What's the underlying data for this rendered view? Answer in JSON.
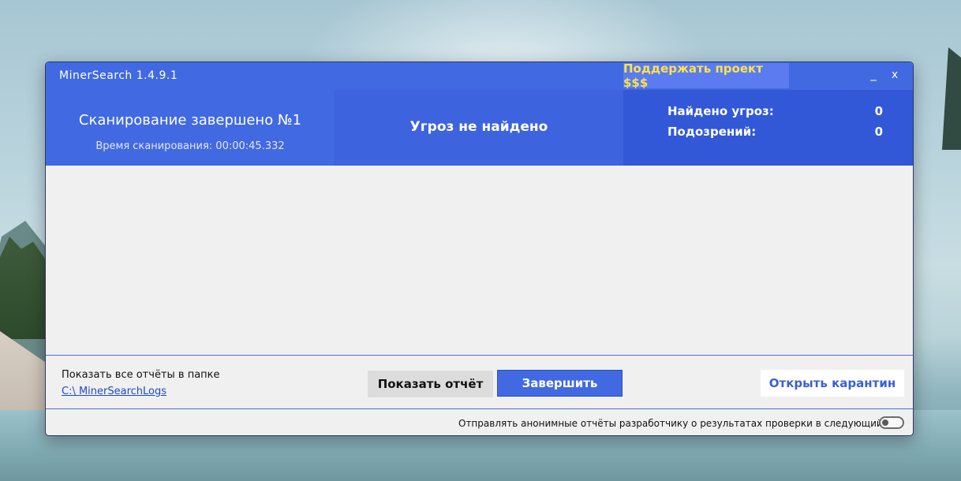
{
  "window": {
    "title": "MinerSearch 1.4.9.1",
    "support_label": "Поддержать проект $$$",
    "minimize_glyph": "_",
    "close_glyph": "x"
  },
  "summary": {
    "scan_title": "Сканирование завершено №1",
    "scan_time": "Время сканирования: 00:00:45.332",
    "status": "Угроз не найдено",
    "threats_label": "Найдено угроз:",
    "threats_value": "0",
    "suspicions_label": "Подозрений:",
    "suspicions_value": "0"
  },
  "footer": {
    "logs_label": "Показать все отчёты в папке",
    "logs_path": "C:\\ MinerSearchLogs",
    "show_report_label": "Показать отчёт",
    "finish_label": "Завершить",
    "quarantine_label": "Открыть карантин",
    "consent_text": "Отправлять анонимные отчёты разработчику о результатах проверки в следующий раз",
    "consent_enabled": false
  },
  "colors": {
    "accent": "#4169E1",
    "support_text": "#FFE24A"
  }
}
